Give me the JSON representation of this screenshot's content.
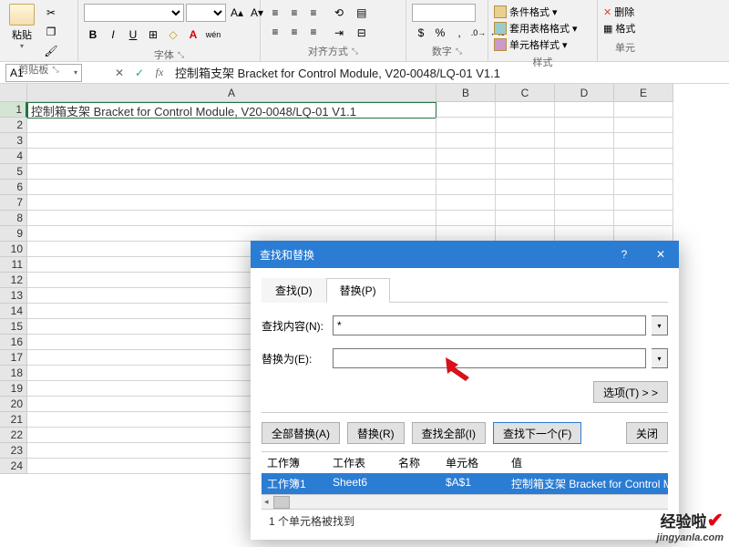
{
  "ribbon": {
    "clipboard": {
      "paste": "粘贴",
      "label": "剪贴板"
    },
    "font": {
      "label": "字体",
      "bold": "B",
      "italic": "I",
      "underline": "U",
      "border": "⊞",
      "fill": "◇",
      "color": "A",
      "pinyin": "wén"
    },
    "alignment": {
      "label": "对齐方式",
      "wrap": "▤",
      "merge": "⊟"
    },
    "number": {
      "label": "数字"
    },
    "styles": {
      "label": "样式",
      "cond": "条件格式",
      "table": "套用表格格式",
      "cell": "单元格样式"
    },
    "cells": {
      "delete": "删除",
      "format": "格式",
      "label": "单元"
    }
  },
  "formula_bar": {
    "name_box": "A1",
    "cancel": "✕",
    "confirm": "✓",
    "fx": "fx",
    "value": "控制箱支架 Bracket for Control Module, V20-0048/LQ-01 V1.1"
  },
  "grid": {
    "columns": [
      "A",
      "B",
      "C",
      "D",
      "E"
    ],
    "rows": [
      1,
      2,
      3,
      4,
      5,
      6,
      7,
      8,
      9,
      10,
      11,
      12,
      13,
      14,
      15,
      16,
      17,
      18,
      19,
      20,
      21,
      22,
      23,
      24
    ],
    "a1": "控制箱支架 Bracket for Control Module, V20-0048/LQ-01 V1.1"
  },
  "dialog": {
    "title": "查找和替换",
    "help": "?",
    "close": "✕",
    "tab_find": "查找(D)",
    "tab_replace": "替换(P)",
    "find_label": "查找内容(N):",
    "replace_label": "替换为(E):",
    "find_value": "*",
    "replace_value": "",
    "options": "选项(T) > >",
    "btn_replace_all": "全部替换(A)",
    "btn_replace": "替换(R)",
    "btn_find_all": "查找全部(I)",
    "btn_find_next": "查找下一个(F)",
    "btn_close": "关闭",
    "col_book": "工作簿",
    "col_sheet": "工作表",
    "col_name": "名称",
    "col_cell": "单元格",
    "col_value": "值",
    "res_book": "工作簿1",
    "res_sheet": "Sheet6",
    "res_name": "",
    "res_cell": "$A$1",
    "res_value": "控制箱支架 Bracket for Control M",
    "status": "1 个单元格被找到"
  },
  "watermark": {
    "cn": "经验啦",
    "en": "jingyanla.com"
  }
}
